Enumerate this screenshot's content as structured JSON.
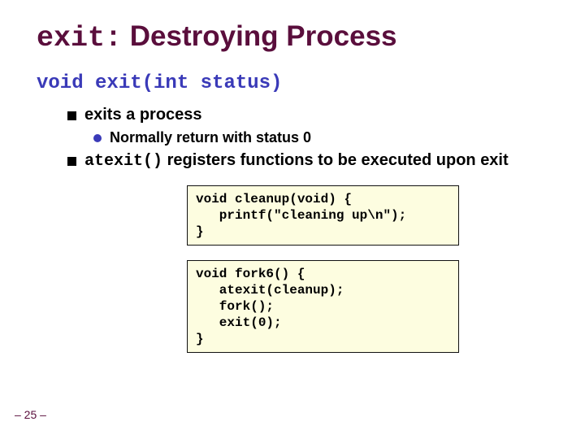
{
  "title": {
    "mono": "exit:",
    "rest": " Destroying Process"
  },
  "signature": "void exit(int status)",
  "bullets": {
    "b1": "exits a process",
    "b1a": "Normally return with status 0",
    "b2_mono": "atexit()",
    "b2_rest": " registers functions to be executed upon exit"
  },
  "code": {
    "block1": "void cleanup(void) {\n   printf(\"cleaning up\\n\");\n}",
    "block2": "void fork6() {\n   atexit(cleanup);\n   fork();\n   exit(0);\n}"
  },
  "page": "– 25 –"
}
